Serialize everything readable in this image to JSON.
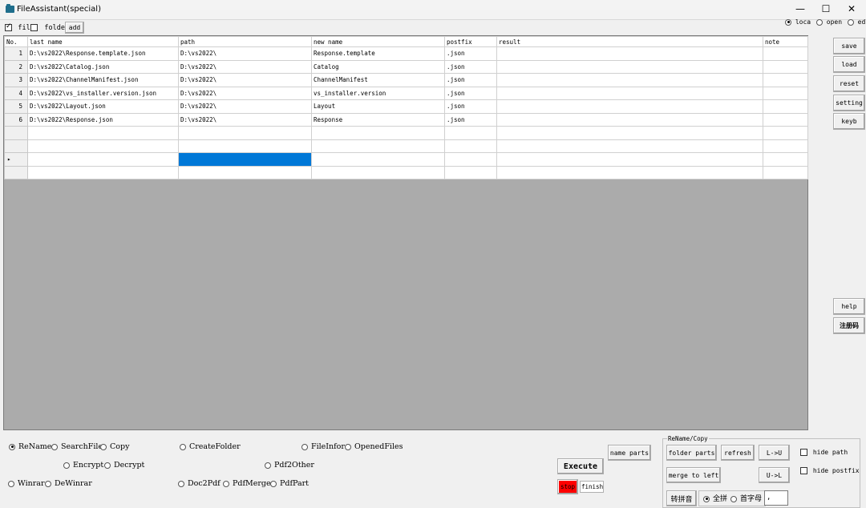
{
  "window": {
    "title": "FileAssistant(special)",
    "min_icon": "minimize-icon",
    "max_icon": "maximize-icon",
    "close_icon": "close-icon",
    "min_glyph": "—",
    "max_glyph": "☐",
    "close_glyph": "✕"
  },
  "toolbar": {
    "file_label": "file",
    "file_checked": true,
    "folder_label": "folder",
    "folder_checked": false,
    "add_label": "add",
    "mode_options": [
      "loca",
      "open",
      "edit"
    ],
    "mode_selected": "loca"
  },
  "grid": {
    "columns": [
      "No.",
      "last name",
      "path",
      "new name",
      "postfix",
      "result",
      "note"
    ],
    "rows": [
      {
        "no": "1",
        "last_name": "D:\\vs2022\\Response.template.json",
        "path": "D:\\vs2022\\",
        "new_name": "Response.template",
        "postfix": ".json",
        "result": "",
        "note": ""
      },
      {
        "no": "2",
        "last_name": "D:\\vs2022\\Catalog.json",
        "path": "D:\\vs2022\\",
        "new_name": "Catalog",
        "postfix": ".json",
        "result": "",
        "note": ""
      },
      {
        "no": "3",
        "last_name": "D:\\vs2022\\ChannelManifest.json",
        "path": "D:\\vs2022\\",
        "new_name": "ChannelManifest",
        "postfix": ".json",
        "result": "",
        "note": ""
      },
      {
        "no": "4",
        "last_name": "D:\\vs2022\\vs_installer.version.json",
        "path": "D:\\vs2022\\",
        "new_name": "vs_installer.version",
        "postfix": ".json",
        "result": "",
        "note": ""
      },
      {
        "no": "5",
        "last_name": "D:\\vs2022\\Layout.json",
        "path": "D:\\vs2022\\",
        "new_name": "Layout",
        "postfix": ".json",
        "result": "",
        "note": ""
      },
      {
        "no": "6",
        "last_name": "D:\\vs2022\\Response.json",
        "path": "D:\\vs2022\\",
        "new_name": "Response",
        "postfix": ".json",
        "result": "",
        "note": ""
      }
    ],
    "current_row_marker": "▸"
  },
  "side_buttons": {
    "save": "save",
    "load": "load",
    "reset": "reset",
    "setting": "setting",
    "keyb": "keyb",
    "help": "help",
    "register": "注册码"
  },
  "functions": {
    "selected": "ReName",
    "row1": [
      "ReName",
      "SearchFile",
      "Copy",
      "CreateFolder",
      "FileInfor",
      "OpenedFiles"
    ],
    "row2": [
      "Encrypt",
      "Decrypt",
      "Pdf2Other"
    ],
    "row3": [
      "Winrar",
      "DeWinrar",
      "Doc2Pdf",
      "PdfMerge",
      "PdfPart"
    ]
  },
  "actions": {
    "execute": "Execute",
    "stop": "stop",
    "finish": "finish",
    "name_parts": "name parts",
    "stop_color": "#ff0000"
  },
  "rename_copy": {
    "title": "ReName/Copy",
    "folder_parts": "folder parts",
    "refresh": "refresh",
    "l_to_u": "L->U",
    "u_to_l": "U->L",
    "merge_to_left": "merge to left",
    "pinyin": "转拼音",
    "full_pinyin": "全拼",
    "initials": "首字母",
    "pinyin_selected": "全拼",
    "separator_value": ",",
    "hide_path": "hide path",
    "hide_postfix": "hide postfix"
  }
}
